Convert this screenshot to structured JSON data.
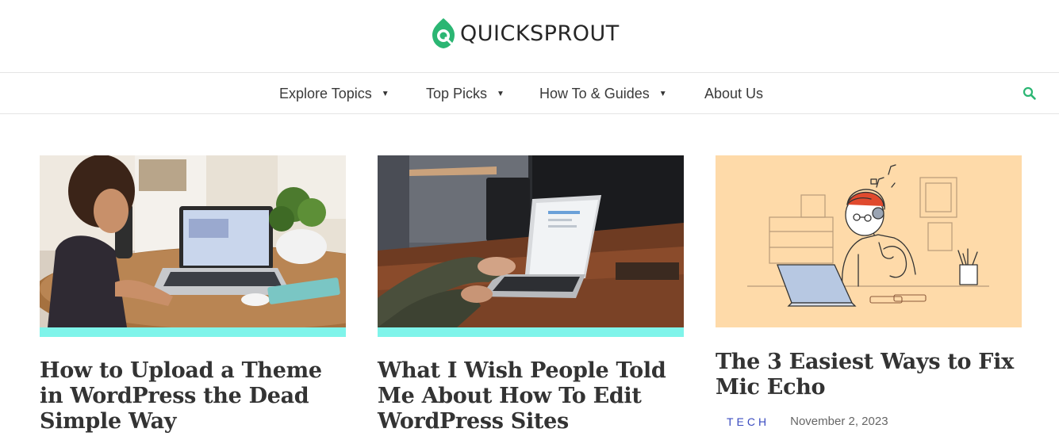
{
  "header": {
    "logo_text": "QUICKSPROUT",
    "brand_color": "#2bb673"
  },
  "nav": {
    "items": [
      {
        "label": "Explore Topics",
        "has_dropdown": true
      },
      {
        "label": "Top Picks",
        "has_dropdown": true
      },
      {
        "label": "How To & Guides",
        "has_dropdown": true
      },
      {
        "label": "About Us",
        "has_dropdown": false
      }
    ],
    "caret": "▼",
    "search_icon": "search-icon"
  },
  "cards": [
    {
      "title": "How to Upload a Theme in WordPress the Dead Simple Way",
      "image": "woman-working-on-laptop-photo"
    },
    {
      "title": "What I Wish People Told Me About How To Edit WordPress Sites",
      "image": "hands-typing-on-laptop-photo"
    },
    {
      "title": "The 3 Easiest Ways to Fix Mic Echo",
      "image": "man-with-headphones-illustration",
      "category": "TECH",
      "date": "November 2, 2023"
    }
  ],
  "colors": {
    "accent_bar": "#7ff4ea",
    "category": "#3b4cc0",
    "illustration_bg": "#fedaa9"
  }
}
